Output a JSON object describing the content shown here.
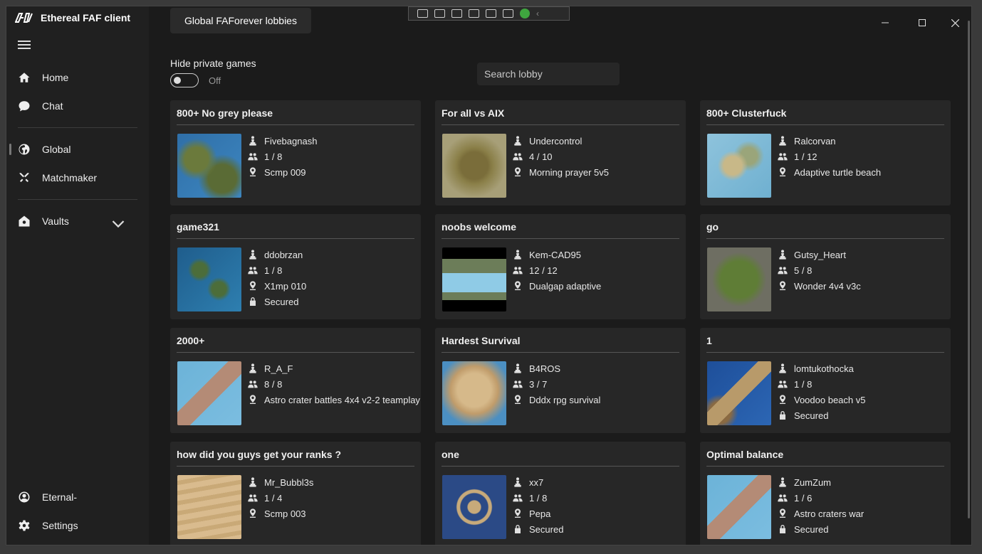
{
  "app": {
    "title": "Ethereal FAF client"
  },
  "sidebar": {
    "items": [
      {
        "label": "Home",
        "icon": "home-icon"
      },
      {
        "label": "Chat",
        "icon": "chat-icon"
      },
      {
        "label": "Global",
        "icon": "globe-icon"
      },
      {
        "label": "Matchmaker",
        "icon": "crossed-swords-icon"
      },
      {
        "label": "Vaults",
        "icon": "vault-icon"
      }
    ],
    "user": "Eternal-",
    "settings": "Settings"
  },
  "main": {
    "tab": "Global FAForever lobbies",
    "hide_private_label": "Hide private games",
    "hide_private_state": "Off",
    "search_placeholder": "Search lobby"
  },
  "lobbies": [
    {
      "title": "800+ No grey please",
      "host": "Fivebagnash",
      "players": "1 / 8",
      "map": "Scmp 009",
      "secured": "",
      "thumb": "blue-green"
    },
    {
      "title": "For all vs AIX",
      "host": "Undercontrol",
      "players": "4 / 10",
      "map": "Morning prayer 5v5",
      "secured": "",
      "thumb": "olive"
    },
    {
      "title": "800+ Clusterfuck",
      "host": "Ralcorvan",
      "players": "1 / 12",
      "map": "Adaptive turtle beach",
      "secured": "",
      "thumb": "light-blue"
    },
    {
      "title": "game321",
      "host": "ddobrzan",
      "players": "1 / 8",
      "map": "X1mp 010",
      "secured": "Secured",
      "thumb": "ocean-islands"
    },
    {
      "title": "noobs welcome",
      "host": "Kem-CAD95",
      "players": "12 / 12",
      "map": "Dualgap adaptive",
      "secured": "",
      "thumb": "dualgap"
    },
    {
      "title": "go",
      "host": "Gutsy_Heart",
      "players": "5 / 8",
      "map": "Wonder 4v4 v3c",
      "secured": "",
      "thumb": "grass-rock"
    },
    {
      "title": "2000+",
      "host": "R_A_F",
      "players": "8 / 8",
      "map": "Astro crater battles 4x4 v2-2 teamplay",
      "secured": "",
      "thumb": "astro"
    },
    {
      "title": "Hardest Survival",
      "host": "B4ROS",
      "players": "3 / 7",
      "map": "Dddx rpg survival",
      "secured": "",
      "thumb": "desert"
    },
    {
      "title": "1",
      "host": "lomtukothocka",
      "players": "1 / 8",
      "map": "Voodoo beach v5",
      "secured": "Secured",
      "thumb": "voodoo"
    },
    {
      "title": "how did you guys get your ranks ?",
      "host": "Mr_Bubbl3s",
      "players": "1 / 4",
      "map": "Scmp 003",
      "secured": "",
      "thumb": "sand"
    },
    {
      "title": "one",
      "host": "xx7",
      "players": "1 / 8",
      "map": "Pepa",
      "secured": "Secured",
      "thumb": "pepa"
    },
    {
      "title": "Optimal balance",
      "host": "ZumZum",
      "players": "1 / 6",
      "map": "Astro craters war",
      "secured": "Secured",
      "thumb": "astro"
    }
  ],
  "colors": {
    "sidebar": "#202020",
    "main": "#1b1b1b",
    "card": "#272727"
  }
}
